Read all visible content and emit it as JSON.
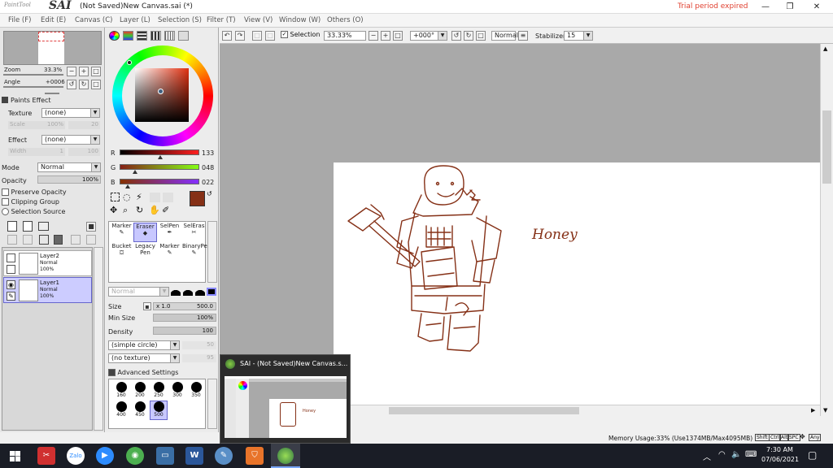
{
  "app": {
    "logo_small": "PaintTool",
    "logo_big": "SAI",
    "window_title": "(Not Saved)New Canvas.sai (*)",
    "trial_text": "Trial period expired"
  },
  "menu": {
    "items": [
      "File (F)",
      "Edit (E)",
      "Canvas (C)",
      "Layer (L)",
      "Selection (S)",
      "Filter (T)",
      "View (V)",
      "Window (W)",
      "Others (O)"
    ]
  },
  "navigator": {
    "zoom_label": "Zoom",
    "zoom_value": "33.3%",
    "angle_label": "Angle",
    "angle_value": "+0006"
  },
  "paints_effect": {
    "header": "Paints Effect",
    "texture_label": "Texture",
    "texture_value": "(none)",
    "scale_label": "Scale",
    "scale_value": "100%",
    "scale_num": "20",
    "effect_label": "Effect",
    "effect_value": "(none)",
    "width_label": "Width",
    "width_value": "1",
    "width_num": "100"
  },
  "layer_props": {
    "mode_label": "Mode",
    "mode_value": "Normal",
    "opacity_label": "Opacity",
    "opacity_value": "100%",
    "preserve_opacity": "Preserve Opacity",
    "clipping_group": "Clipping Group",
    "selection_source": "Selection Source"
  },
  "layers": [
    {
      "name": "Layer2",
      "mode": "Normal",
      "opacity": "100%",
      "selected": false
    },
    {
      "name": "Layer1",
      "mode": "Normal",
      "opacity": "100%",
      "selected": true
    }
  ],
  "color": {
    "r_label": "R",
    "r_value": "133",
    "g_label": "G",
    "g_value": "048",
    "b_label": "B",
    "b_value": "022",
    "current": "#853016"
  },
  "tools": {
    "row1": [
      "Marker",
      "Eraser",
      "SelPen",
      "SelEras"
    ],
    "row2": [
      "Bucket",
      "Legacy Pen",
      "Marker",
      "BinaryPe"
    ],
    "selected": "Eraser"
  },
  "brush": {
    "mode_value": "Normal",
    "size_label": "Size",
    "size_mult": "x 1.0",
    "size_value": "500.0",
    "min_size_label": "Min Size",
    "min_size_value": "100%",
    "density_label": "Density",
    "density_value": "100",
    "shape_value": "(simple circle)",
    "shape_num": "50",
    "texture_value": "(no texture)",
    "texture_num": "95",
    "advanced_label": "Advanced Settings",
    "sizes": [
      "160",
      "200",
      "250",
      "300",
      "350",
      "400",
      "450",
      "500"
    ],
    "selected_size": "500"
  },
  "toolbar": {
    "selection_label": "Selection",
    "zoom_value": "33.33%",
    "angle_value": "+000°",
    "mode_value": "Normal",
    "stabilizer_label": "Stabilizer",
    "stabilizer_value": "15"
  },
  "canvas": {
    "drawing_text": "Honey"
  },
  "status": {
    "memory": "Memory Usage:33% (Use1374MB/Max4095MB)",
    "keys": [
      "Shift",
      "Ctrl",
      "Alt",
      "SPC"
    ],
    "any": "Any"
  },
  "taskbar_preview": {
    "title": "SAI - (Not Saved)New Canvas.s..."
  },
  "taskbar": {
    "time": "7:30 AM",
    "date": "07/06/2021"
  }
}
